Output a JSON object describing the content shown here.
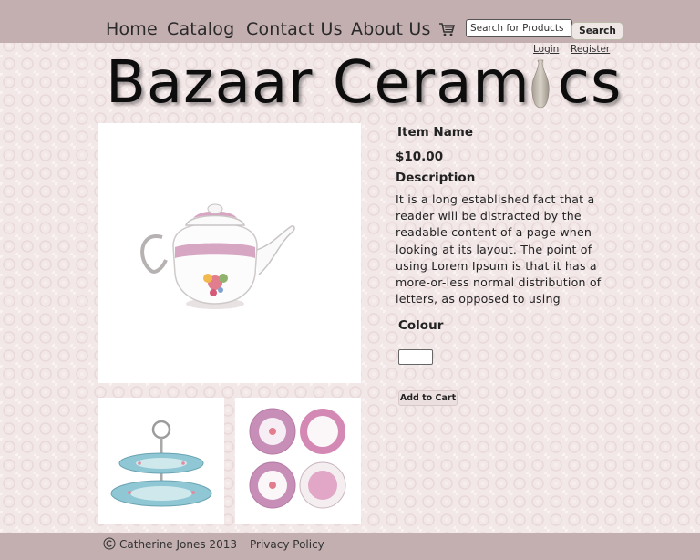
{
  "nav": {
    "home": "Home",
    "catalog": "Catalog",
    "contact": "Contact Us",
    "about": "About Us",
    "cart_icon": "shopping-cart-icon"
  },
  "search": {
    "value": "Search for Products",
    "button_label": "Search"
  },
  "account": {
    "login": "Login",
    "register": "Register"
  },
  "logo": {
    "text": "Bazaar Ceram",
    "text_end": "cs"
  },
  "product": {
    "name": "Item Name",
    "price": "$10.00",
    "description_heading": "Description",
    "description": "It is a long established fact that a reader will be distracted by the readable content of a page when looking at its layout. The point of using Lorem Ipsum is that it has a more-or-less normal distribution of letters, as opposed to using",
    "colour_label": "Colour",
    "colour_value": "",
    "add_to_cart": "Add to Cart"
  },
  "footer": {
    "copyright": "Catherine Jones 2013",
    "privacy": "Privacy Policy"
  },
  "colors": {
    "bar": "#c3aeb0",
    "background": "#f3e8e8"
  }
}
